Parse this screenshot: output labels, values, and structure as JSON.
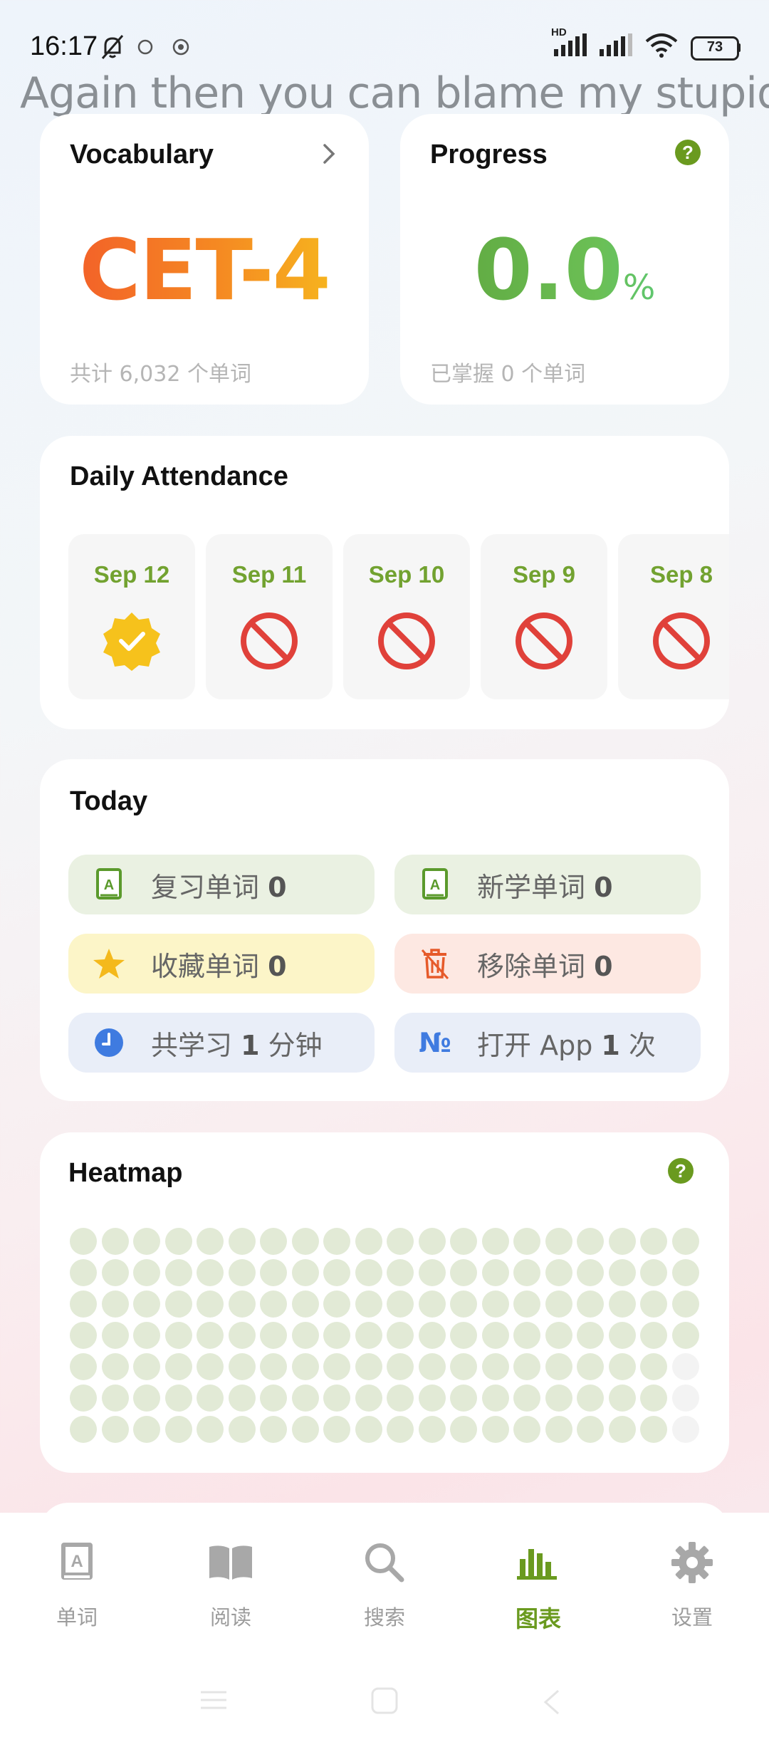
{
  "status_bar": {
    "time": "16:17",
    "battery": "73",
    "network": "HD"
  },
  "lyric_banner": "Again then you can blame my stupid",
  "vocabulary_card": {
    "title": "Vocabulary",
    "book": "CET-4",
    "subtitle": "共计 6,032 个单词"
  },
  "progress_card": {
    "title": "Progress",
    "value": "0.0",
    "unit": "%",
    "subtitle": "已掌握 0 个单词",
    "help": "?"
  },
  "attendance": {
    "title": "Daily Attendance",
    "days": [
      {
        "label": "Sep 12",
        "status": "checked"
      },
      {
        "label": "Sep 11",
        "status": "missed"
      },
      {
        "label": "Sep 10",
        "status": "missed"
      },
      {
        "label": "Sep 9",
        "status": "missed"
      },
      {
        "label": "Sep 8",
        "status": "missed"
      }
    ]
  },
  "today": {
    "title": "Today",
    "review": {
      "label": "复习单词",
      "count": "0"
    },
    "new": {
      "label": "新学单词",
      "count": "0"
    },
    "starred": {
      "label": "收藏单词",
      "count": "0"
    },
    "removed": {
      "label": "移除单词",
      "count": "0"
    },
    "study_time": {
      "prefix": "共学习",
      "count": "1",
      "suffix": "分钟"
    },
    "opens": {
      "prefix": "打开 App",
      "count": "1",
      "suffix": "次"
    }
  },
  "heatmap": {
    "title": "Heatmap",
    "help": "?",
    "rows": 7,
    "cols": 20,
    "empty_cells": 3
  },
  "bottom_nav": {
    "items": [
      {
        "label": "单词",
        "icon": "book-icon"
      },
      {
        "label": "阅读",
        "icon": "open-book-icon"
      },
      {
        "label": "搜索",
        "icon": "search-icon"
      },
      {
        "label": "图表",
        "icon": "chart-icon",
        "active": true
      },
      {
        "label": "设置",
        "icon": "gear-icon"
      }
    ]
  },
  "colors": {
    "accent": "#6a9a1f",
    "missed": "#e0413a",
    "checked": "#f6c21c"
  }
}
